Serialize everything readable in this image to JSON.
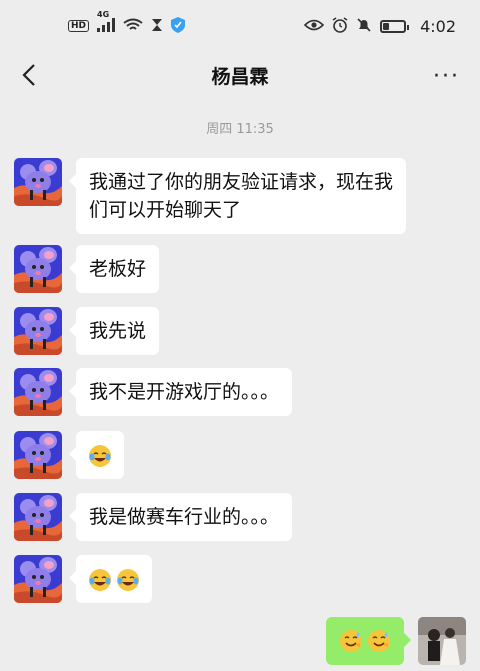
{
  "status_bar": {
    "network_badge": "HD",
    "signal_label": "4G",
    "time": "4:02"
  },
  "header": {
    "title": "杨昌霖",
    "back_icon": "chevron-left-icon",
    "more_icon": "more-dots-icon",
    "more_text": "···"
  },
  "chat": {
    "time_divider": "周四 11:35",
    "messages": [
      {
        "sender": "other",
        "text": "我通过了你的朋友验证请求，现在我们可以开始聊天了"
      },
      {
        "sender": "other",
        "text": "老板好"
      },
      {
        "sender": "other",
        "text": "我先说"
      },
      {
        "sender": "other",
        "text": "我不是开游戏厅的。。。"
      },
      {
        "sender": "other",
        "emoji": [
          "crying-laughing-emoji"
        ]
      },
      {
        "sender": "other",
        "text": "我是做赛车行业的。。。"
      },
      {
        "sender": "other",
        "emoji": [
          "crying-laughing-emoji",
          "crying-laughing-emoji"
        ]
      },
      {
        "sender": "me",
        "emoji": [
          "grinning-sweat-emoji",
          "grinning-sweat-emoji"
        ]
      }
    ]
  },
  "colors": {
    "background": "#ededed",
    "bubble_other": "#ffffff",
    "bubble_me": "#95ec69",
    "avatar_bg": "#3a3bd0",
    "avatar_accent": "#e86a3a"
  }
}
